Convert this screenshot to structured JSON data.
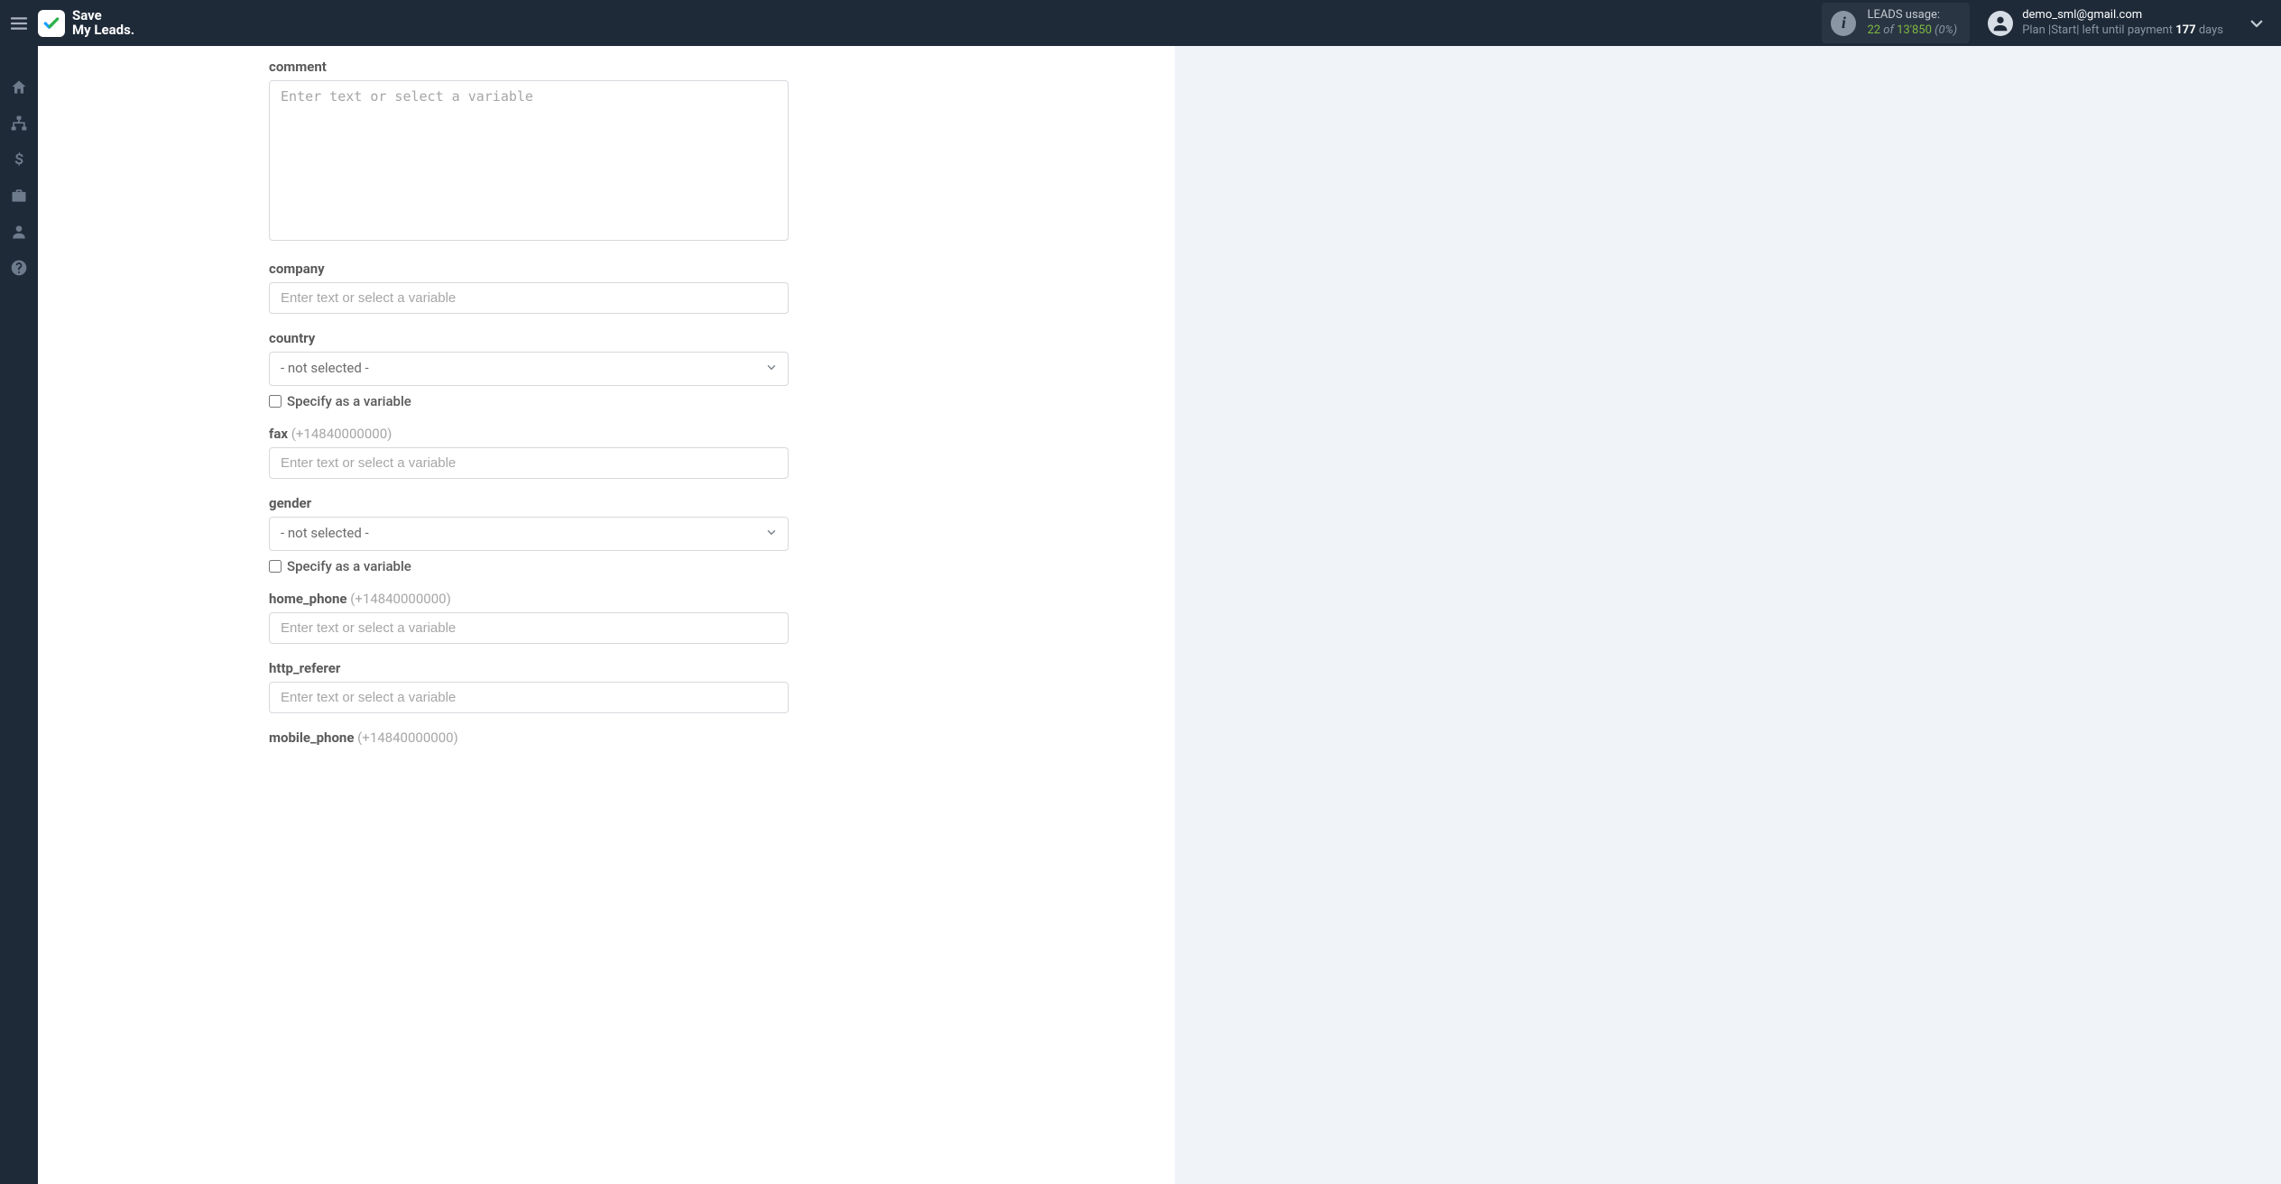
{
  "brand": {
    "line1": "Save",
    "line2": "My Leads."
  },
  "leads_usage": {
    "title": "LEADS usage:",
    "used": "22",
    "of": "of",
    "total": "13'850",
    "pct": "(0%)"
  },
  "user": {
    "email": "demo_sml@gmail.com",
    "plan_prefix": "Plan |Start| left until payment ",
    "plan_days": "177",
    "plan_suffix": " days"
  },
  "sidebar": {
    "items": [
      {
        "name": "home"
      },
      {
        "name": "connections"
      },
      {
        "name": "billing"
      },
      {
        "name": "briefcase"
      },
      {
        "name": "profile"
      },
      {
        "name": "help"
      }
    ]
  },
  "form": {
    "placeholder": "Enter text or select a variable",
    "select_not_selected": "- not selected -",
    "specify_variable": "Specify as a variable",
    "fields": {
      "comment": {
        "label": "comment"
      },
      "company": {
        "label": "company"
      },
      "country": {
        "label": "country"
      },
      "fax": {
        "label": "fax",
        "hint": "(+14840000000)"
      },
      "gender": {
        "label": "gender"
      },
      "home_phone": {
        "label": "home_phone",
        "hint": "(+14840000000)"
      },
      "http_referer": {
        "label": "http_referer"
      },
      "mobile_phone": {
        "label": "mobile_phone",
        "hint": "(+14840000000)"
      }
    }
  }
}
